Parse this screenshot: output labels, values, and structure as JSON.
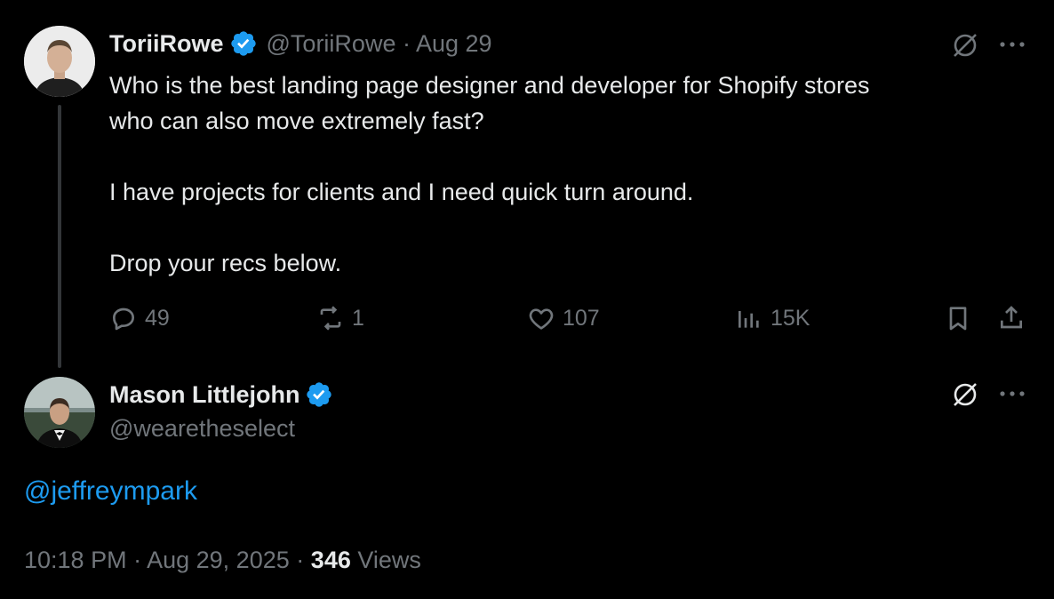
{
  "colors": {
    "background": "#000000",
    "text": "#e7e9ea",
    "muted": "#71767b",
    "link": "#1d9bf0",
    "verified": "#1d9bf0"
  },
  "original_tweet": {
    "author_name": "ToriiRowe",
    "author_handle": "@ToriiRowe",
    "separator": "·",
    "date": "Aug 29",
    "text": "Who is the best landing page designer and developer for Shopify stores\nwho can also move extremely fast?\n\nI have projects for clients and I need quick turn around.\n\nDrop your recs below.",
    "stats": {
      "replies": "49",
      "reposts": "1",
      "likes": "107",
      "views": "15K"
    },
    "icons": [
      "grok-icon",
      "more-icon",
      "reply-icon",
      "repost-icon",
      "like-icon",
      "views-icon",
      "bookmark-icon",
      "share-icon"
    ]
  },
  "reply_tweet": {
    "author_name": "Mason Littlejohn",
    "author_handle": "@wearetheselect",
    "mention": "@jeffreympark",
    "time": "10:18 PM",
    "separator": "·",
    "date": "Aug 29, 2025",
    "views_count": "346",
    "views_label": "Views"
  }
}
